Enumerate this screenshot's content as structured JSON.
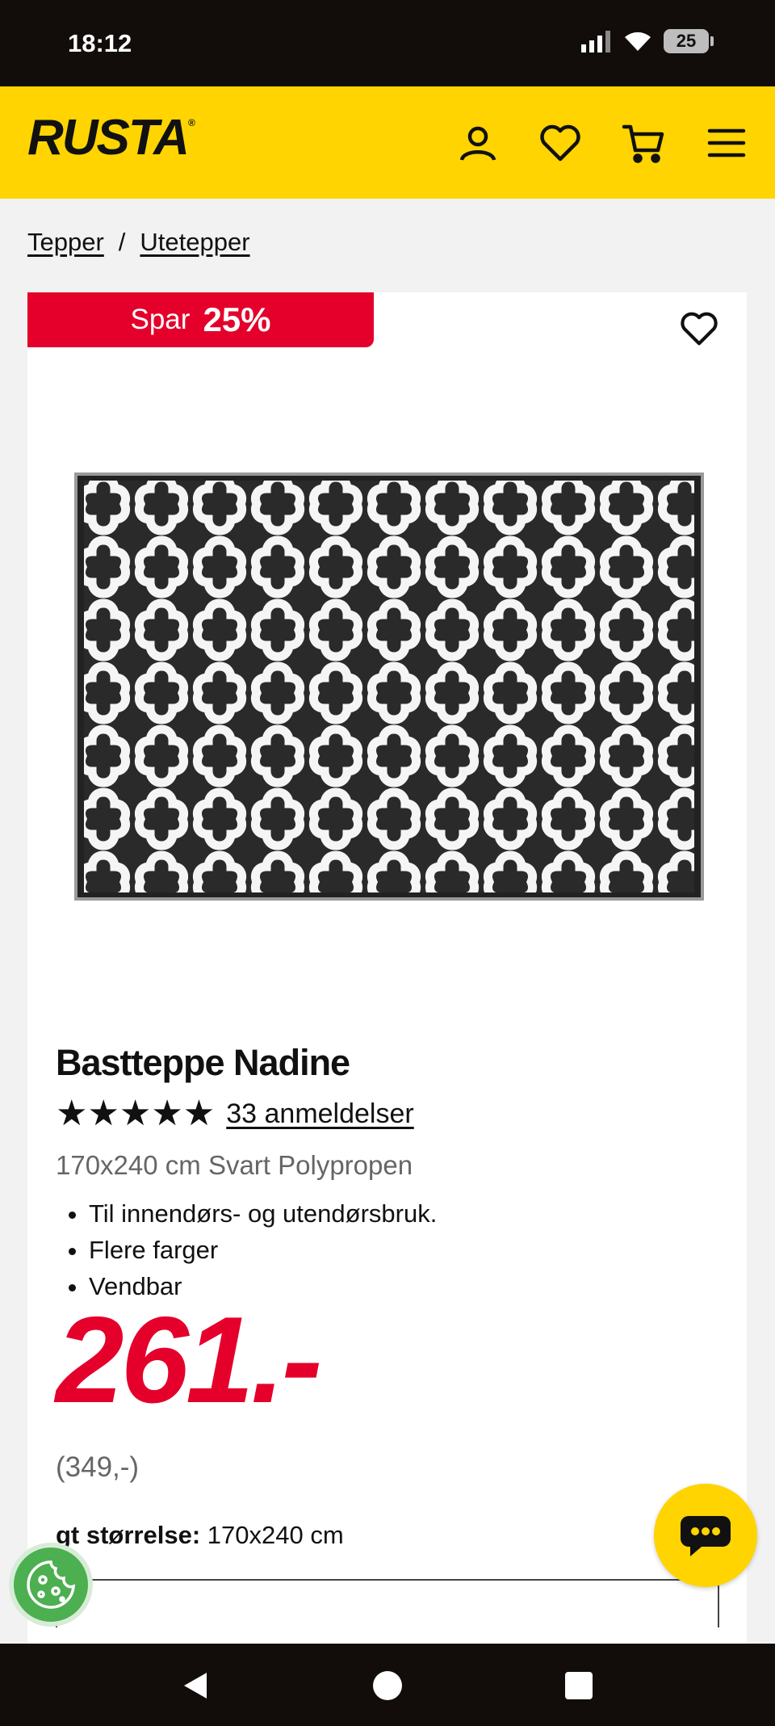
{
  "status_bar": {
    "time": "18:12",
    "battery": "25"
  },
  "header": {
    "logo": "RUSTA",
    "logo_mark": "®"
  },
  "breadcrumb": {
    "items": [
      "Tepper",
      "Utetepper"
    ],
    "separator": "/"
  },
  "product": {
    "badge": {
      "label": "Spar",
      "percent": "25%"
    },
    "title": "Bastteppe Nadine",
    "rating": {
      "stars": "★★★★★",
      "value": 5,
      "reviews": "33 anmeldelser"
    },
    "variant": "170x240 cm Svart Polypropen",
    "features": [
      "Til innendørs- og utendørsbruk.",
      "Flere farger",
      "Vendbar"
    ],
    "price": "261.-",
    "old_price": "(349,-)",
    "size_label": "gt størrelse:",
    "size_value": "170x240 cm"
  },
  "colors": {
    "brand_yellow": "#ffd400",
    "sale_red": "#e4002b"
  },
  "icons": [
    "account-icon",
    "wishlist-icon",
    "cart-icon",
    "menu-icon",
    "heart-icon",
    "chat-icon",
    "cookie-icon",
    "back-icon",
    "home-icon",
    "recents-icon"
  ]
}
